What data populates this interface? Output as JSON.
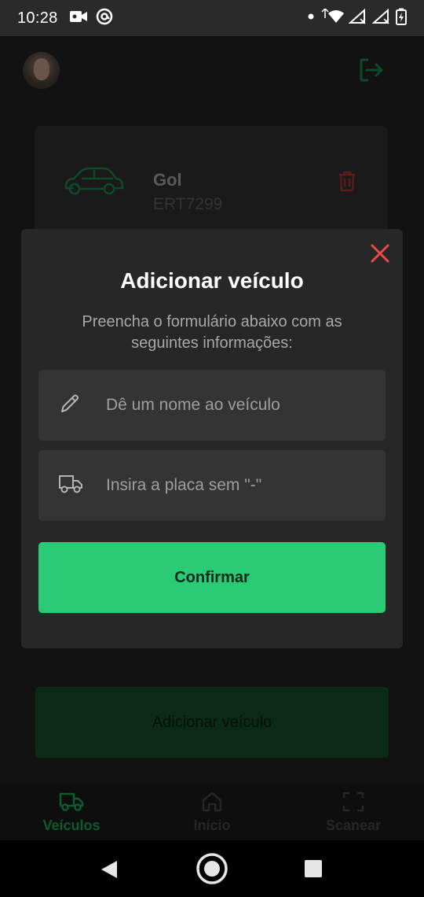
{
  "status_bar": {
    "time": "10:28",
    "icons": [
      "video-camera-icon",
      "at-sign-icon",
      "notification-dot-icon",
      "wifi-icon",
      "signal-icon",
      "signal-icon",
      "battery-icon"
    ]
  },
  "header": {
    "avatar": "user-avatar",
    "logout_icon": "logout-icon"
  },
  "vehicles": [
    {
      "name": "Gol",
      "plate": "ERT7299",
      "icon": "car-icon",
      "delete_icon": "trash-icon"
    }
  ],
  "add_vehicle_button": {
    "label": "Adicionar veículo"
  },
  "bottom_nav": {
    "items": [
      {
        "label": "Veículos",
        "icon": "truck-icon",
        "active": true
      },
      {
        "label": "Início",
        "icon": "home-icon",
        "active": false
      },
      {
        "label": "Scanear",
        "icon": "scan-icon",
        "active": false
      }
    ]
  },
  "modal": {
    "title": "Adicionar veículo",
    "description": "Preencha o formulário abaixo com as seguintes informações:",
    "name_field": {
      "placeholder": "Dê um nome ao veículo",
      "value": ""
    },
    "plate_field": {
      "placeholder": "Insira a placa sem \"-\"",
      "value": ""
    },
    "confirm_label": "Confirmar",
    "close_icon": "close-icon"
  },
  "colors": {
    "accent": "#2bcb76",
    "danger": "#e94b4b",
    "modal_bg": "#272727",
    "field_bg": "#343434"
  }
}
